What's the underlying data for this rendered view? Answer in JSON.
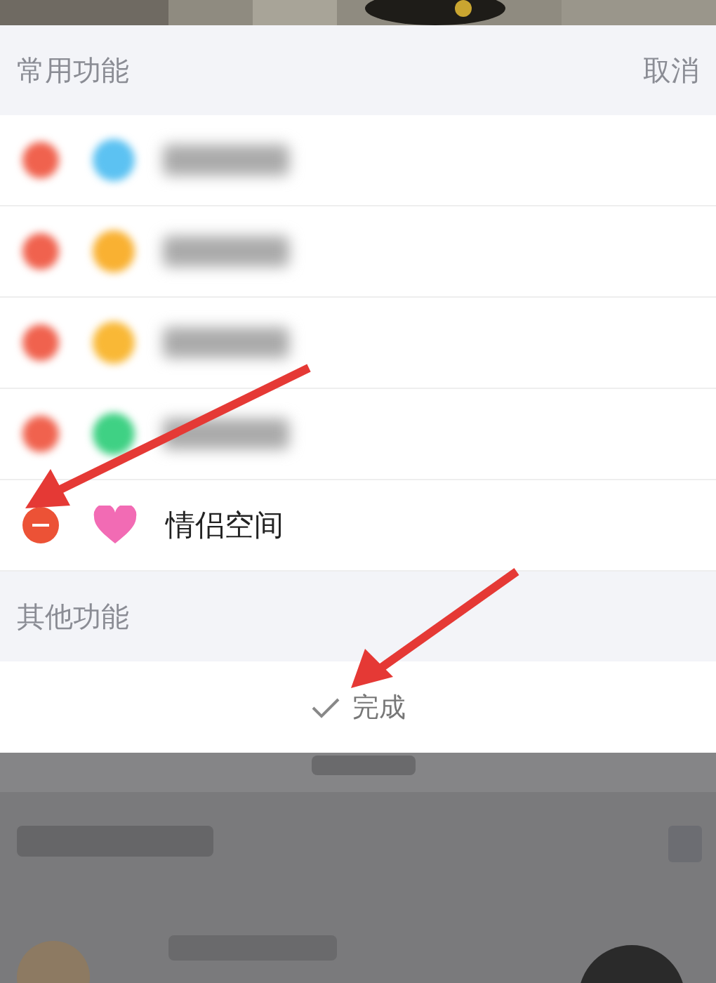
{
  "sections": [
    {
      "title": "常用功能",
      "action": "取消",
      "items": [
        {
          "kind": "blurred",
          "color": "#5cc2f2"
        },
        {
          "kind": "blurred",
          "color": "#f9b132"
        },
        {
          "kind": "blurred",
          "color": "#f9b836"
        },
        {
          "kind": "blurred",
          "color": "#3fd184"
        },
        {
          "kind": "plain",
          "label": "情侣空间"
        }
      ]
    },
    {
      "title": "其他功能"
    }
  ],
  "done_button": {
    "label": "完成"
  }
}
